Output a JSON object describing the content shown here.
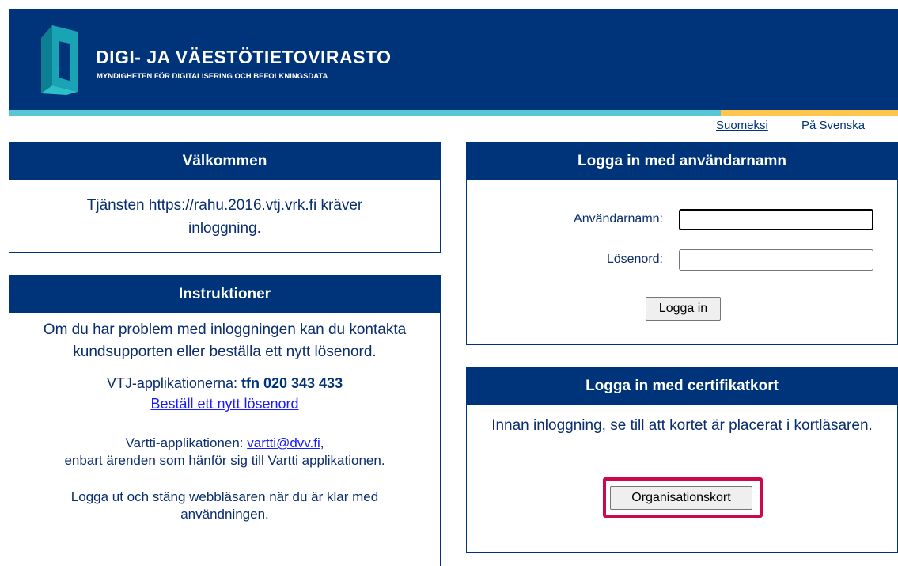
{
  "header": {
    "title": "DIGI- JA VÄESTÖTIETOVIRASTO",
    "subtitle": "MYNDIGHETEN FÖR DIGITALISERING OCH BEFOLKNINGSDATA"
  },
  "lang": {
    "finnish": "Suomeksi",
    "swedish": "På Svenska"
  },
  "welcome": {
    "title": "Välkommen",
    "text": "Tjänsten https://rahu.2016.vtj.vrk.fi kräver inloggning."
  },
  "instructions": {
    "title": "Instruktioner",
    "intro": "Om du har problem med inloggningen kan du kontakta kundsupporten eller beställa ett nytt lösenord.",
    "vtj_label": "VTJ-applikationerna:",
    "vtj_phone": "tfn 020 343 433",
    "new_password_link": "Beställ ett nytt lösenord",
    "vartti_label": "Vartti-applikationen:",
    "vartti_email": "vartti@dvv.fi",
    "vartti_note": "enbart ärenden som hänför sig till Vartti applikationen.",
    "logout_note": "Logga ut och stäng webbläsaren när du är klar med användningen."
  },
  "login": {
    "title": "Logga in med användarnamn",
    "username_label": "Användarnamn:",
    "username_value": "",
    "password_label": "Lösenord:",
    "password_value": "",
    "submit": "Logga in"
  },
  "certificate": {
    "title": "Logga in med certifikatkort",
    "text": "Innan inloggning, se till att kortet är placerat i kortläsaren.",
    "button": "Organisationskort"
  },
  "colors": {
    "brand_navy": "#00347a",
    "accent_teal": "#58c7d3",
    "accent_yellow": "#ffc54d",
    "highlight": "#cc0a4b"
  }
}
